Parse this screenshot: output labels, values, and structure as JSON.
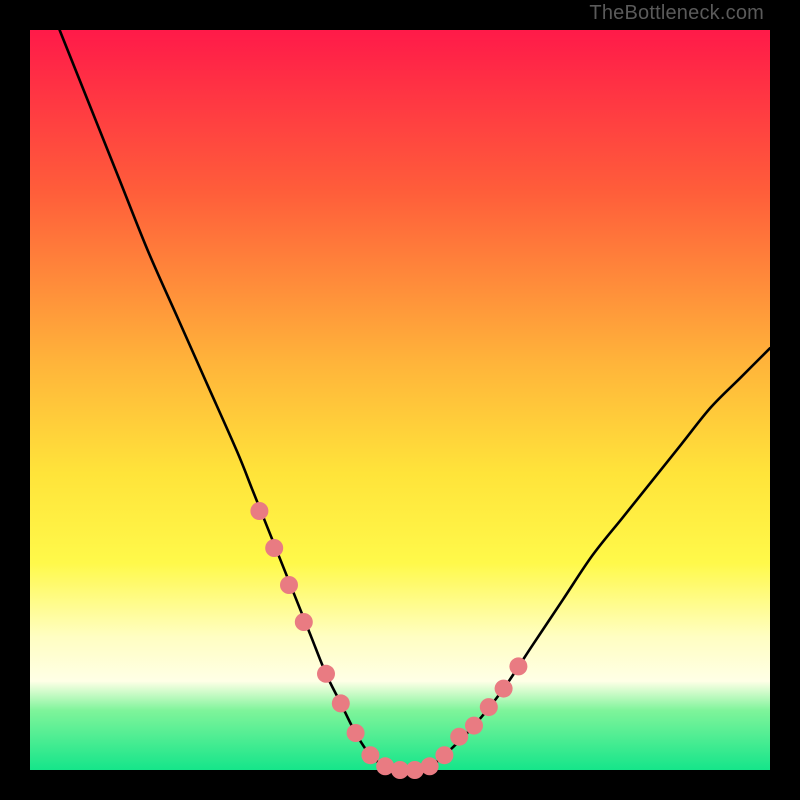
{
  "watermark": "TheBottleneck.com",
  "chart_data": {
    "type": "line",
    "title": "",
    "xlabel": "",
    "ylabel": "",
    "xlim": [
      0,
      100
    ],
    "ylim": [
      0,
      100
    ],
    "series": [
      {
        "name": "bottleneck-curve",
        "x": [
          4,
          8,
          12,
          16,
          20,
          24,
          28,
          30,
          32,
          34,
          36,
          38,
          40,
          42,
          44,
          46,
          48,
          50,
          52,
          54,
          56,
          60,
          64,
          68,
          72,
          76,
          80,
          84,
          88,
          92,
          96,
          100
        ],
        "values": [
          100,
          90,
          80,
          70,
          61,
          52,
          43,
          38,
          33,
          28,
          23,
          18,
          13,
          9,
          5,
          2,
          0.5,
          0,
          0,
          0.5,
          2,
          6,
          11,
          17,
          23,
          29,
          34,
          39,
          44,
          49,
          53,
          57
        ]
      }
    ],
    "markers": {
      "name": "highlight-points",
      "x": [
        31,
        33,
        35,
        37,
        40,
        42,
        44,
        46,
        48,
        50,
        52,
        54,
        56,
        58,
        60,
        62,
        64,
        66
      ],
      "values": [
        35,
        30,
        25,
        20,
        13,
        9,
        5,
        2,
        0.5,
        0,
        0,
        0.5,
        2,
        4.5,
        6,
        8.5,
        11,
        14
      ]
    },
    "gradient_stops": [
      {
        "pct": 0,
        "color": "#ff1a49"
      },
      {
        "pct": 22,
        "color": "#ff5e3a"
      },
      {
        "pct": 45,
        "color": "#ffb43a"
      },
      {
        "pct": 60,
        "color": "#ffe43a"
      },
      {
        "pct": 72,
        "color": "#fff94a"
      },
      {
        "pct": 82,
        "color": "#fffec2"
      },
      {
        "pct": 88,
        "color": "#ffffe6"
      },
      {
        "pct": 92,
        "color": "#7ef49a"
      },
      {
        "pct": 100,
        "color": "#15e58a"
      }
    ],
    "marker_color": "#e97b82",
    "marker_radius": 9,
    "curve_color": "#000000"
  }
}
